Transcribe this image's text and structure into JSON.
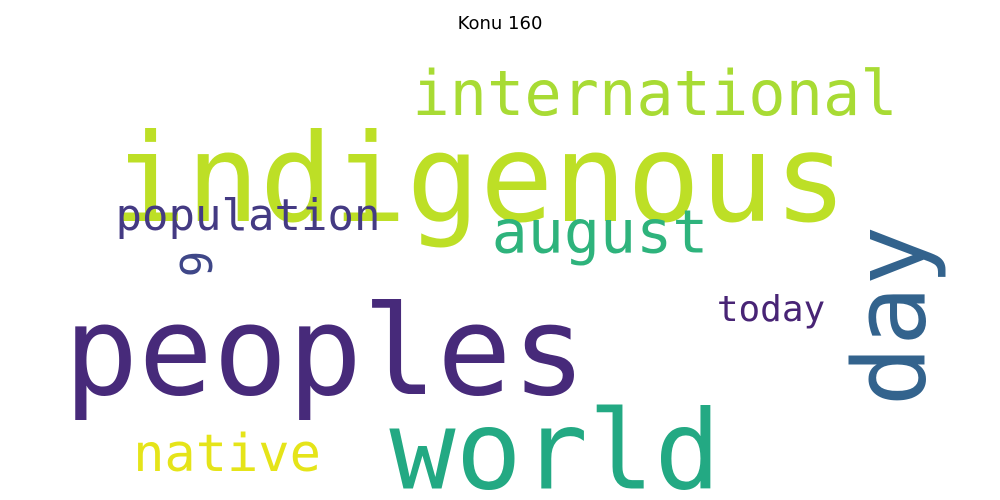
{
  "title": "Konu 160",
  "words": [
    {
      "text": "indigenous",
      "weight": 1.0,
      "color": "#bddf26"
    },
    {
      "text": "peoples",
      "weight": 0.95,
      "color": "#472a7a"
    },
    {
      "text": "world",
      "weight": 0.85,
      "color": "#23a983"
    },
    {
      "text": "day",
      "weight": 0.75,
      "color": "#33638d"
    },
    {
      "text": "international",
      "weight": 0.55,
      "color": "#a8db34"
    },
    {
      "text": "august",
      "weight": 0.45,
      "color": "#2eb37c"
    },
    {
      "text": "native",
      "weight": 0.4,
      "color": "#e5e419"
    },
    {
      "text": "population",
      "weight": 0.3,
      "color": "#443a83"
    },
    {
      "text": "today",
      "weight": 0.25,
      "color": "#482475"
    },
    {
      "text": "9",
      "weight": 0.3,
      "color": "#3f4788"
    }
  ]
}
